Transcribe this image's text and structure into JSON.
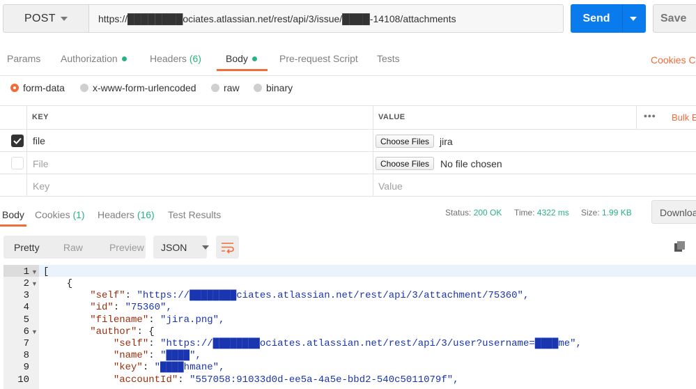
{
  "request": {
    "method": "POST",
    "url": "https://████████ociates.atlassian.net/rest/api/3/issue/████-14108/attachments",
    "send_label": "Send",
    "save_label": "Save"
  },
  "request_tabs": [
    {
      "label": "Params"
    },
    {
      "label": "Authorization"
    },
    {
      "label": "Headers",
      "count": "(6)"
    },
    {
      "label": "Body"
    },
    {
      "label": "Pre-request Script"
    },
    {
      "label": "Tests"
    }
  ],
  "cookies_label": "Cookies",
  "code_label_partial": "C",
  "body_types": [
    "form-data",
    "x-www-form-urlencoded",
    "raw",
    "binary"
  ],
  "selected_body_type": "form-data",
  "kv_table": {
    "key_header": "KEY",
    "value_header": "VALUE",
    "more_label": "•••",
    "bulk_edit_label": "Bulk E",
    "rows": [
      {
        "checked": true,
        "key": "file",
        "choose_label": "Choose Files",
        "file_name": "jira"
      },
      {
        "checked": false,
        "key_placeholder": "File",
        "choose_label": "Choose Files",
        "file_name": "No file chosen"
      },
      {
        "checked": false,
        "key_placeholder": "Key",
        "value_placeholder": "Value"
      }
    ]
  },
  "response_tabs": [
    {
      "label": "Body"
    },
    {
      "label": "Cookies",
      "count": "(1)"
    },
    {
      "label": "Headers",
      "count": "(16)"
    },
    {
      "label": "Test Results"
    }
  ],
  "response_meta": {
    "status_label": "Status:",
    "status_value": "200 OK",
    "time_label": "Time:",
    "time_value": "4322 ms",
    "size_label": "Size:",
    "size_value": "1.99 KB",
    "download_label": "Downloa"
  },
  "format_options": [
    "Pretty",
    "Raw",
    "Preview"
  ],
  "selected_format": "Pretty",
  "language": "JSON",
  "code_lines": [
    {
      "n": "1",
      "text": "["
    },
    {
      "n": "2",
      "text": "    {"
    },
    {
      "n": "3",
      "key": "\"self\"",
      "val": "\"https://████████ciates.atlassian.net/rest/api/3/attachment/75360\","
    },
    {
      "n": "4",
      "key": "\"id\"",
      "val": "\"75360\","
    },
    {
      "n": "5",
      "key": "\"filename\"",
      "val": "\"jira.png\","
    },
    {
      "n": "6",
      "key": "\"author\"",
      "val": "{"
    },
    {
      "n": "7",
      "key": "\"self\"",
      "val": "\"https://████████ociates.atlassian.net/rest/api/3/user?username=████me\","
    },
    {
      "n": "8",
      "key": "\"name\"",
      "val": "\"████\","
    },
    {
      "n": "9",
      "key": "\"key\"",
      "val": "\"████hmane\","
    },
    {
      "n": "10",
      "key": "\"accountId\"",
      "val": "\"557058:91033d0d-ee5a-4a5e-bbd2-540c5011079f\","
    }
  ],
  "colors": {
    "accent": "#f26b3a",
    "send_blue": "#097bed",
    "success_green": "#26b47f"
  }
}
